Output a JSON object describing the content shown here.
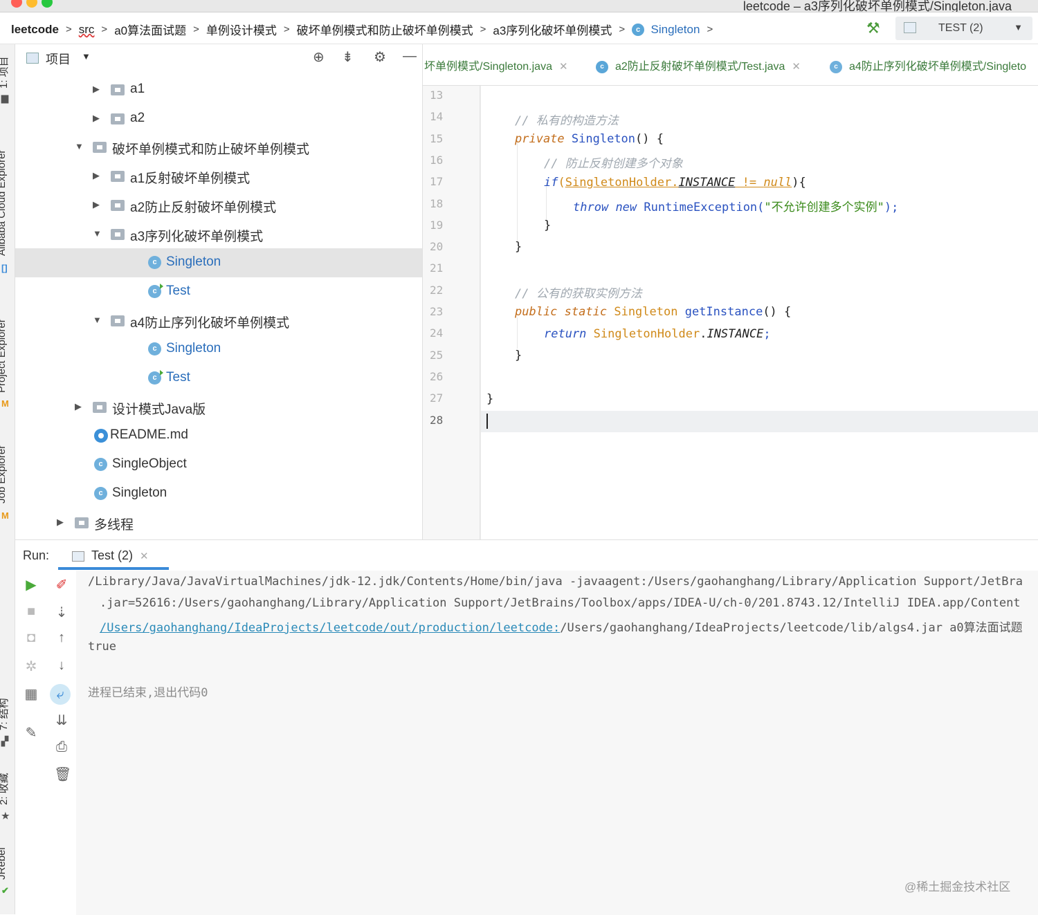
{
  "window": {
    "title": "leetcode – a3序列化破坏单例模式/Singleton.java"
  },
  "breadcrumbs": [
    "leetcode",
    "src",
    "a0算法面试题",
    "单例设计模式",
    "破坏单例模式和防止破坏单例模式",
    "a3序列化破坏单例模式",
    "Singleton"
  ],
  "toolbar": {
    "run_config": "TEST (2)"
  },
  "left_strip": {
    "tabs": [
      "1: 项目",
      "Alibaba Cloud Explorer",
      "Project Explorer",
      "Job Explorer",
      "7: 结构",
      "2: 收藏",
      "JRebel"
    ]
  },
  "project": {
    "header_label": "项目",
    "tree": [
      {
        "label": "a1",
        "type": "folder",
        "state": "collapsed",
        "level": 2
      },
      {
        "label": "a2",
        "type": "folder",
        "state": "collapsed",
        "level": 2
      },
      {
        "label": "破坏单例模式和防止破坏单例模式",
        "type": "folder",
        "state": "expanded",
        "level": 1
      },
      {
        "label": "a1反射破坏单例模式",
        "type": "folder",
        "state": "collapsed",
        "level": 2
      },
      {
        "label": "a2防止反射破坏单例模式",
        "type": "folder",
        "state": "collapsed",
        "level": 2
      },
      {
        "label": "a3序列化破坏单例模式",
        "type": "folder",
        "state": "expanded",
        "level": 2
      },
      {
        "label": "Singleton",
        "type": "class",
        "selected": true,
        "level": 3
      },
      {
        "label": "Test",
        "type": "main-class",
        "level": 3
      },
      {
        "label": "a4防止序列化破坏单例模式",
        "type": "folder",
        "state": "expanded",
        "level": 2
      },
      {
        "label": "Singleton",
        "type": "class",
        "level": 3
      },
      {
        "label": "Test",
        "type": "main-class",
        "level": 3
      },
      {
        "label": "设计模式Java版",
        "type": "folder",
        "state": "collapsed",
        "level": 1
      },
      {
        "label": "README.md",
        "type": "markdown",
        "level": 1
      },
      {
        "label": "SingleObject",
        "type": "class",
        "level": 1
      },
      {
        "label": "Singleton",
        "type": "class",
        "level": 1
      },
      {
        "label": "多线程",
        "type": "folder",
        "state": "collapsed",
        "level": 0
      }
    ]
  },
  "editor": {
    "tabs": [
      {
        "label": "坏单例模式/Singleton.java",
        "closable": true
      },
      {
        "label": "a2防止反射破坏单例模式/Test.java",
        "closable": true
      },
      {
        "label": "a4防止序列化破坏单例模式/Singleto",
        "closable": false
      }
    ],
    "line_numbers": [
      "13",
      "14",
      "15",
      "16",
      "17",
      "18",
      "19",
      "20",
      "21",
      "22",
      "23",
      "24",
      "25",
      "26",
      "27",
      "28"
    ],
    "current_line": "28",
    "code": {
      "l14_comment": "// 私有的构造方法",
      "l15_kw": "private",
      "l15_name": "Singleton",
      "l15_rest": "() {",
      "l16_comment": "// 防止反射创建多个对象",
      "l17_if": "if",
      "l17_open": "(",
      "l17_holder": "SingletonHolder.",
      "l17_inst": "INSTANCE",
      "l17_ne": " != ",
      "l17_null": "null",
      "l17_close": "){",
      "l18_throw": "throw",
      "l18_new": "new",
      "l18_exc": "RuntimeException(",
      "l18_str": "\"不允许创建多个实例\"",
      "l18_end": ");",
      "l19": "}",
      "l20": "}",
      "l22_comment": "// 公有的获取实例方法",
      "l23_public": "public",
      "l23_static": "static",
      "l23_type": "Singleton",
      "l23_method": "getInstance",
      "l23_rest": "() {",
      "l24_return": "return",
      "l24_holder": "SingletonHolder",
      "l24_dot": ".",
      "l24_inst": "INSTANCE",
      "l24_semi": ";",
      "l25": "}",
      "l27": "}"
    }
  },
  "run": {
    "label": "Run:",
    "tab": "Test (2)",
    "output": {
      "line1": "/Library/Java/JavaVirtualMachines/jdk-12.jdk/Contents/Home/bin/java -javaagent:/Users/gaohanghang/Library/Application Support/JetBra",
      "line2": ".jar=52616:/Users/gaohanghang/Library/Application Support/JetBrains/Toolbox/apps/IDEA-U/ch-0/201.8743.12/IntelliJ IDEA.app/Content",
      "line3_link": "/Users/gaohanghang/IdeaProjects/leetcode/out/production/leetcode:",
      "line3_rest": "/Users/gaohanghang/IdeaProjects/leetcode/lib/algs4.jar a0算法面试题",
      "line4": "true",
      "line5": "进程已结束,退出代码0"
    }
  },
  "watermark": "@稀土掘金技术社区",
  "colors": {
    "keyword": "#c36e1c",
    "class_ref": "#d08a1a",
    "string": "#3a8a1a",
    "comment": "#a0a8b0",
    "link": "#2a8ab8",
    "selection": "#e4e4e4"
  }
}
